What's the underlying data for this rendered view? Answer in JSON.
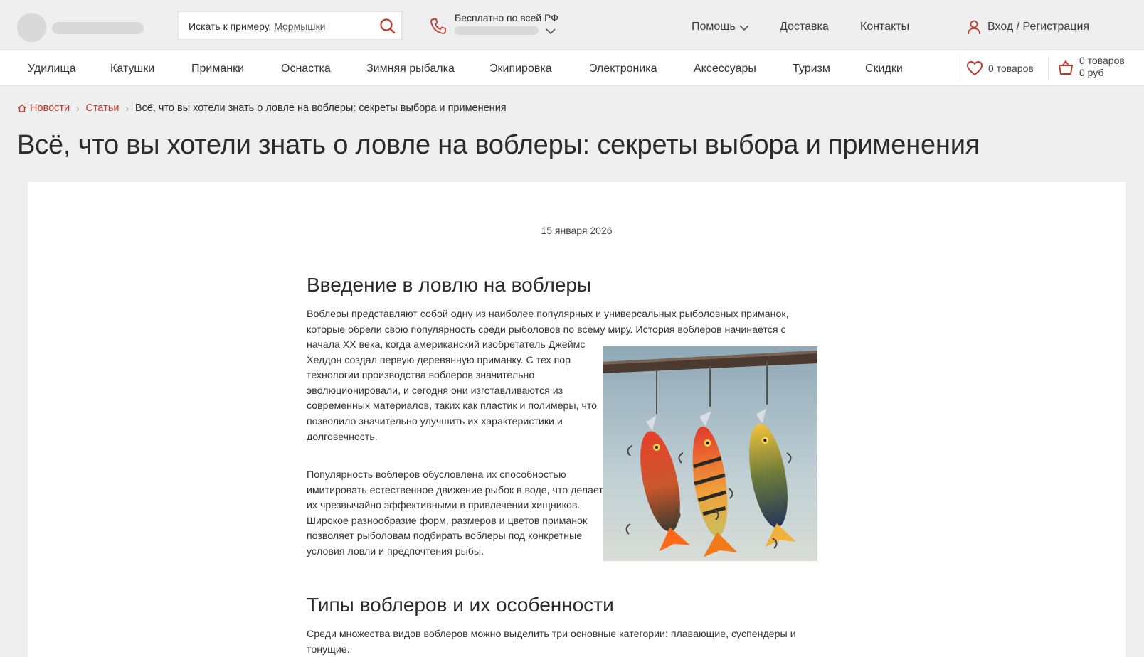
{
  "header": {
    "search_prefix": "Искать к примеру,",
    "search_hint": "Мормышки",
    "free_label": "Бесплатно по всей РФ",
    "help": "Помощь",
    "delivery": "Доставка",
    "contacts": "Контакты",
    "login": "Вход / Регистрация"
  },
  "nav": {
    "items": [
      "Удилища",
      "Катушки",
      "Приманки",
      "Оснастка",
      "Зимняя рыбалка",
      "Экипировка",
      "Электроника",
      "Аксессуары",
      "Туризм",
      "Скидки"
    ],
    "favorites": "0 товаров",
    "cart_items": "0 товаров",
    "cart_sum": "0 руб"
  },
  "breadcrumb": {
    "items": [
      "Новости",
      "Статьи"
    ],
    "current": "Всё, что вы хотели знать о ловле на воблеры: секреты выбора и применения"
  },
  "article": {
    "title": "Всё, что вы хотели знать о ловле на воблеры: секреты выбора и применения",
    "date": "15 января 2026",
    "section1_title": "Введение в ловлю на воблеры",
    "intro_lines": "Воблеры представляют собой одну из наиболее популярных и универсальных рыболовных приманок, которые обрели свою популярность среди рыболовов по всему миру. История воблеров начинается с",
    "intro_rest": "начала XX века, когда американский изобретатель Джеймс Хеддон создал первую деревянную приманку. С тех пор технологии производства воблеров значительно эволюционировали, и сегодня они изготавливаются из современных материалов, таких как пластик и полимеры, что позволило значительно улучшить их характеристики и долговечность.",
    "para2": "Популярность воблеров обусловлена их способностью имитировать естественное движение рыбок в воде, что делает их чрезвычайно эффективными в привлечении хищников. Широкое разнообразие форм, размеров и цветов приманок позволяет рыболовам подбирать воблеры под конкретные условия ловли и предпочтения рыбы.",
    "section2_title": "Типы воблеров и их особенности",
    "para3": "Среди множества видов воблеров можно выделить три основные категории: плавающие, суспендеры и тонущие."
  },
  "colors": {
    "accent": "#c0392b",
    "background": "#efefef",
    "card": "#ffffff"
  }
}
